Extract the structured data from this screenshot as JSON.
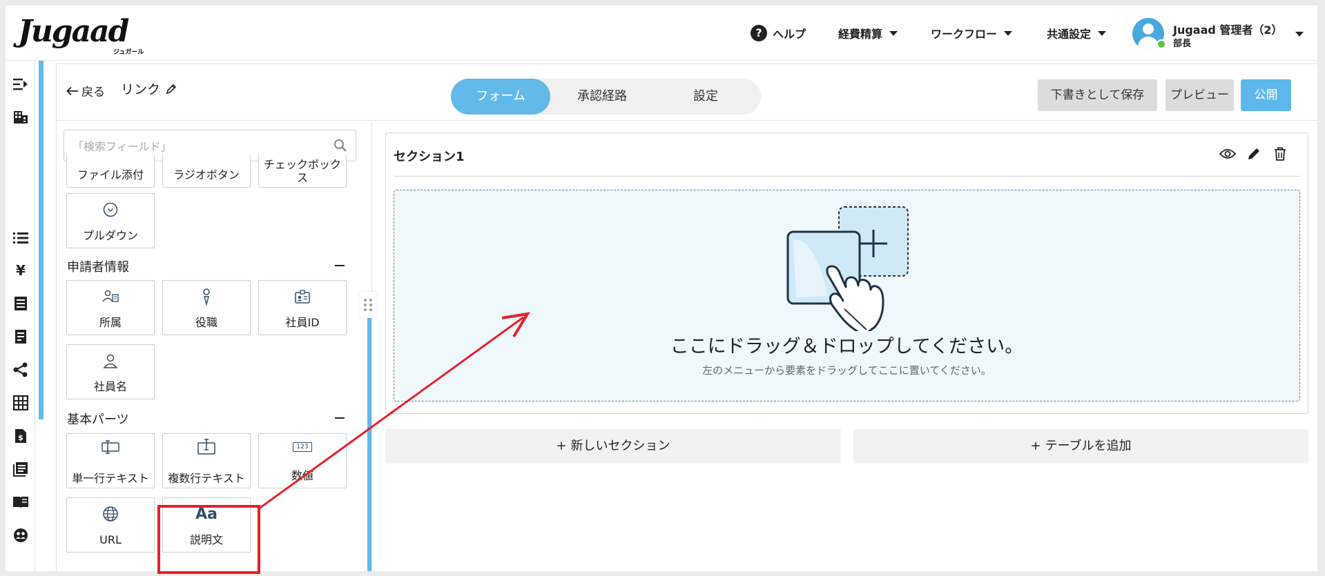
{
  "header": {
    "logo_text": "Jugaad",
    "logo_subtext": "ジュガール",
    "help_label": "ヘルプ",
    "nav": [
      {
        "label": "経費精算"
      },
      {
        "label": "ワークフロー"
      },
      {
        "label": "共通設定"
      }
    ],
    "user": {
      "name": "Jugaad 管理者（2）",
      "role": "部長"
    }
  },
  "toolbar": {
    "back_label": "戻る",
    "form_name": "リンク",
    "tabs": [
      {
        "label": "フォーム",
        "active": true
      },
      {
        "label": "承認経路",
        "active": false
      },
      {
        "label": "設定",
        "active": false
      }
    ],
    "save_draft_label": "下書きとして保存",
    "preview_label": "プレビュー",
    "publish_label": "公開"
  },
  "palette": {
    "search_placeholder": "「検索フィールド」",
    "top_items": [
      {
        "label": "ファイル添付"
      },
      {
        "label": "ラジオボタン"
      },
      {
        "label": "チェックボックス"
      },
      {
        "label": "プルダウン"
      }
    ],
    "groups": [
      {
        "title": "申請者情報",
        "items": [
          {
            "label": "所属",
            "icon": "department-icon"
          },
          {
            "label": "役職",
            "icon": "position-icon"
          },
          {
            "label": "社員ID",
            "icon": "id-card-icon"
          },
          {
            "label": "社員名",
            "icon": "person-icon"
          }
        ]
      },
      {
        "title": "基本パーツ",
        "items": [
          {
            "label": "単一行テキスト",
            "icon": "single-line-text-icon"
          },
          {
            "label": "複数行テキスト",
            "icon": "multi-line-text-icon"
          },
          {
            "label": "数値",
            "icon": "number-icon",
            "icon_text": "123"
          },
          {
            "label": "URL",
            "icon": "globe-icon"
          },
          {
            "label": "説明文",
            "icon": "text-aa-icon",
            "icon_text": "Aa",
            "highlighted": true
          }
        ]
      }
    ]
  },
  "canvas": {
    "section_title": "セクション1",
    "dropzone_title": "ここにドラッグ＆ドロップしてください。",
    "dropzone_subtitle": "左のメニューから要素をドラッグしてここに置いてください。",
    "add_section_label": "新しいセクション",
    "add_table_label": "テーブルを追加"
  },
  "colors": {
    "accent": "#62b9ea",
    "annotation": "#e8202a"
  }
}
